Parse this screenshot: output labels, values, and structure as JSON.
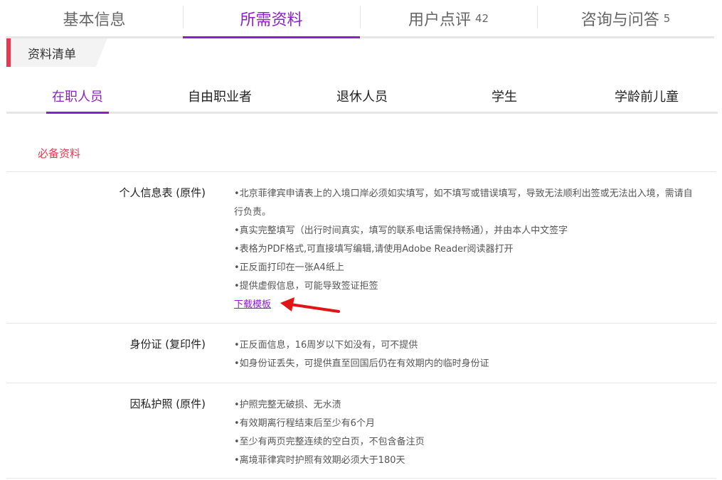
{
  "top_tabs": [
    {
      "label": "基本信息",
      "count": ""
    },
    {
      "label": "所需资料",
      "count": ""
    },
    {
      "label": "用户点评",
      "count": "42"
    },
    {
      "label": "咨询与问答",
      "count": "5"
    }
  ],
  "section_title": "资料清单",
  "sub_tabs": [
    "在职人员",
    "自由职业者",
    "退休人员",
    "学生",
    "学龄前儿童"
  ],
  "required_title": "必备资料",
  "documents": [
    {
      "name": "个人信息表 (原件)",
      "notes": [
        "•北京菲律宾申请表上的入境口岸必须如实填写，如不填写或错误填写，导致无法顺利出签或无法出入境，需请自行负责。",
        "•真实完整填写（出行时间真实，填写的联系电话需保持畅通），并由本人中文签字",
        "•表格为PDF格式,可直接填写编辑,请使用Adobe Reader阅读器打开",
        "•正反面打印在一张A4纸上",
        "•提供虚假信息，可能导致签证拒签"
      ],
      "link": "下载模板"
    },
    {
      "name": "身份证 (复印件)",
      "notes": [
        "•正反面信息，16周岁以下如没有，可不提供",
        "•如身份证丢失，可提供直至回国后仍在有效期内的临时身份证"
      ]
    },
    {
      "name": "因私护照 (原件)",
      "notes": [
        "•护照完整无破损、无水渍",
        "•有效期离行程结束后至少有6个月",
        "•至少有两页完整连续的空白页，不包含备注页",
        "•离境菲律宾时护照有效期必须大于180天"
      ]
    }
  ],
  "colors": {
    "accent": "#8a21c8",
    "red": "#e8384f",
    "arrow": "#e01515"
  }
}
